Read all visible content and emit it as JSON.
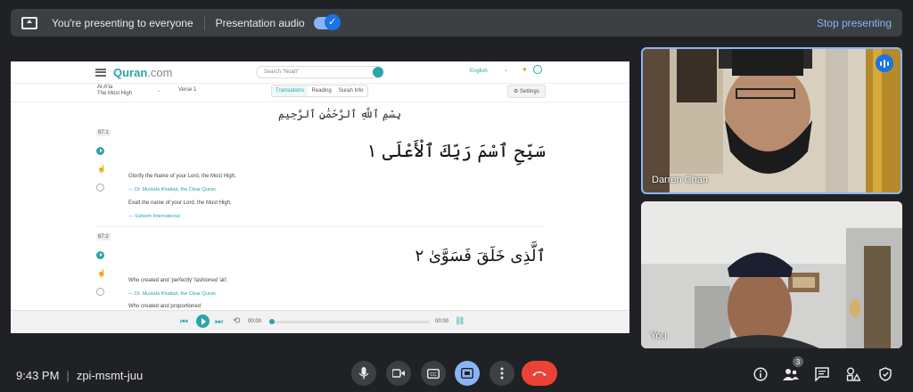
{
  "topbar": {
    "presenting_text": "You're presenting to everyone",
    "audio_label": "Presentation audio",
    "audio_enabled": true,
    "stop_label": "Stop presenting"
  },
  "shared_screen": {
    "nav": {
      "logo_main": "Quran",
      "logo_suffix": ".com",
      "search_placeholder": "Search \"Noah\"",
      "language": "English"
    },
    "subnav": {
      "surah_name": "Al-A'la",
      "surah_meaning": "The Most High",
      "verse_select": "Verse 1",
      "tabs": [
        "Translations",
        "Reading",
        "Surah Info"
      ],
      "active_tab": "Translations",
      "settings_label": "Settings"
    },
    "bismillah": "بِسْمِ ٱللَّهِ ٱلرَّحْمَٰنِ ٱلرَّحِيمِ",
    "verses": [
      {
        "key": "87:1",
        "arabic": "سَبِّحِ ٱسْمَ رَبِّكَ ٱلْأَعْلَى ١",
        "translations": [
          {
            "text": "Glorify the Name of your Lord, the Most High,",
            "source": "— Dr. Mustafa Khattab, the Clear Quran"
          },
          {
            "text": "Exalt the name of your Lord, the Most High,",
            "source": "— Saheeh International"
          }
        ]
      },
      {
        "key": "87:2",
        "arabic": "ٱلَّذِى خَلَقَ فَسَوَّىٰ ٢",
        "translations": [
          {
            "text": "Who created and 'perfectly' fashioned 'all',",
            "source": "— Dr. Mustafa Khattab, the Clear Quran"
          },
          {
            "text": "Who created and proportioned",
            "source": ""
          }
        ]
      }
    ],
    "player": {
      "current_time": "00:00",
      "total_time": "00:00",
      "progress": 0
    }
  },
  "participants": [
    {
      "name": "Darren Chan",
      "speaking": true
    },
    {
      "name": "You",
      "speaking": false
    }
  ],
  "bottombar": {
    "time": "9:43 PM",
    "meeting_code": "zpi-msmt-juu",
    "people_count": "3"
  },
  "colors": {
    "accent": "#8ab4f8",
    "quran_teal": "#2ca4ab",
    "hangup": "#ea4335"
  }
}
